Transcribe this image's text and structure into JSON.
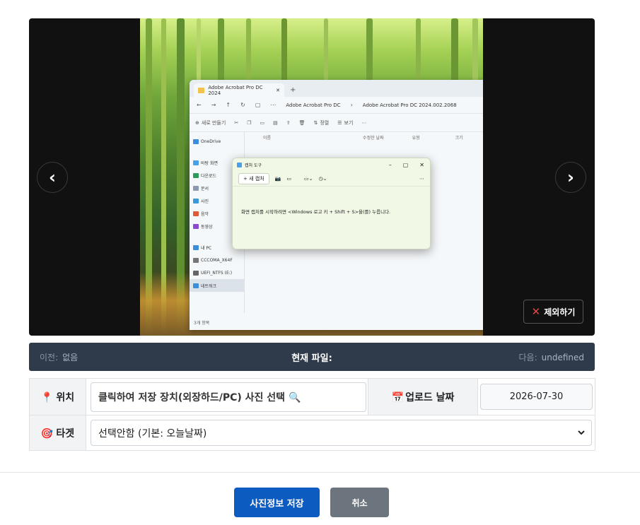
{
  "viewer": {
    "prev_arrow": "‹",
    "next_arrow": "›",
    "exclude_label": "제외하기",
    "screenshot": {
      "explorer_tab_title": "Adobe Acrobat Pro DC 2024",
      "breadcrumb_1": "Adobe Acrobat Pro DC",
      "breadcrumb_2": "Adobe Acrobat Pro DC 2024.002.2068",
      "toolbar_new": "새로 만들기",
      "toolbar_sort": "정렬",
      "toolbar_view": "보기",
      "col_name": "이름",
      "col_modified": "수정한 날짜",
      "col_type": "유형",
      "col_size": "크기",
      "sidebar_items": [
        "OneDrive",
        "바탕 화면",
        "다운로드",
        "문서",
        "사진",
        "음악",
        "동영상",
        "내 PC",
        "CCCOMA_X64F",
        "UEFI_NTFS (E:)",
        "네트워크"
      ],
      "status": "3개 항목",
      "snip_title": "캡처 도구",
      "snip_new": "새 캡처",
      "snip_message": "화면 캡처를 시작하려면 <Windows 로고 키 + Shift + S>을(를) 누릅니다."
    }
  },
  "file_bar": {
    "prev_label": "이전:",
    "prev_value": "없음",
    "current_label": "현재 파일:",
    "next_label": "다음:",
    "next_value": "undefined"
  },
  "form": {
    "location_label": "위치",
    "location_button": "클릭하여 저장 장치(외장하드/PC) 사진 선택 🔍",
    "upload_date_label": "업로드 날짜",
    "upload_date_value": "2026-07-30",
    "target_label": "타겟",
    "target_selected": "선택안함 (기본: 오늘날짜)"
  },
  "actions": {
    "save_label": "사진정보 저장",
    "cancel_label": "취소"
  },
  "colors": {
    "save_button": "#0c5bc1",
    "cancel_button": "#6c757d",
    "file_bar": "#2f3a4b",
    "viewer_bg": "#111111"
  },
  "icons": {
    "location": "pin-icon",
    "upload_date": "calendar-icon",
    "target": "target-icon",
    "exclude": "close-icon"
  }
}
